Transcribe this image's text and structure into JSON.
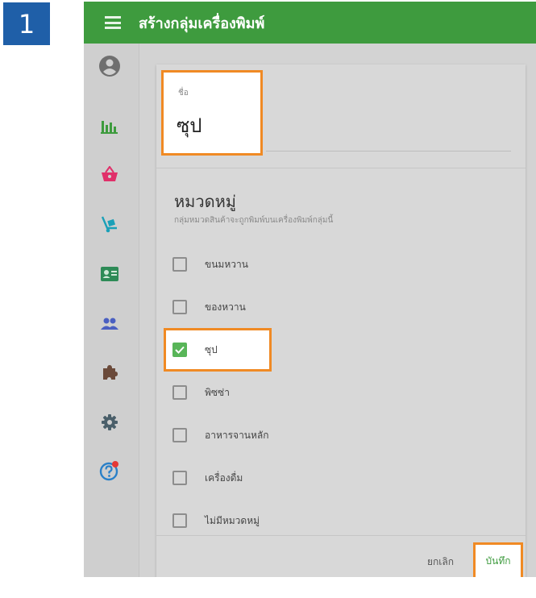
{
  "step": {
    "number": "1"
  },
  "colors": {
    "topbar": "#3e9b3e",
    "highlight": "#f08a24",
    "badge": "#1f5fa8",
    "checked": "#58b558"
  },
  "header": {
    "title": "สร้างกลุ่มเครื่องพิมพ์",
    "menu_icon": "hamburger-menu-icon"
  },
  "sidebar": {
    "items": [
      {
        "icon": "account-circle-icon",
        "color": "#6f6f6f"
      },
      {
        "icon": "bar-chart-icon",
        "color": "#3e9b3e"
      },
      {
        "icon": "basket-icon",
        "color": "#e0306a"
      },
      {
        "icon": "dolly-icon",
        "color": "#1aa0b8"
      },
      {
        "icon": "contact-card-icon",
        "color": "#2e8b57"
      },
      {
        "icon": "people-icon",
        "color": "#4a5fc1"
      },
      {
        "icon": "puzzle-icon",
        "color": "#6b4a3a"
      },
      {
        "icon": "settings-icon",
        "color": "#4a5f6a"
      },
      {
        "icon": "help-icon",
        "color": "#2a80c8",
        "badge_color": "#e53935"
      }
    ]
  },
  "form": {
    "name_label": "ชื่อ",
    "name_value": "ซุป",
    "category_heading": "หมวดหมู่",
    "category_subtitle": "กลุ่มหมวดสินค้าจะถูกพิมพ์บนเครื่องพิมพ์กลุ่มนี้",
    "categories": [
      {
        "label": "ขนมหวาน",
        "checked": false
      },
      {
        "label": "ของหวาน",
        "checked": false
      },
      {
        "label": "ซุป",
        "checked": true
      },
      {
        "label": "พิซซ่า",
        "checked": false
      },
      {
        "label": "อาหารจานหลัก",
        "checked": false
      },
      {
        "label": "เครื่องดื่ม",
        "checked": false
      },
      {
        "label": "ไม่มีหมวดหมู่",
        "checked": false
      }
    ],
    "cancel_label": "ยกเลิก",
    "save_label": "บันทึก"
  }
}
